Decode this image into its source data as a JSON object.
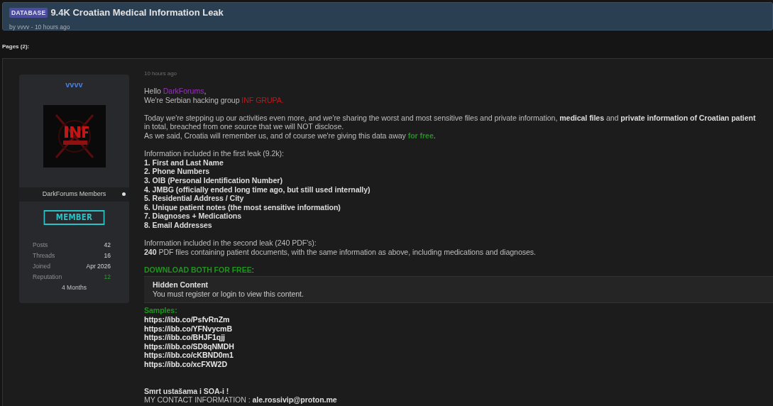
{
  "thread": {
    "tag": "DATABASE",
    "title": "9.4K Croatian Medical Information Leak",
    "byline": "by vvvv - 10 hours ago"
  },
  "pagination": {
    "label": "Pages (2):"
  },
  "post": {
    "author": {
      "username": "vvvv",
      "group": "DarkForums Members",
      "rank": "MEMBER",
      "stats": [
        {
          "label": "Posts",
          "value": "42",
          "kind": "count"
        },
        {
          "label": "Threads",
          "value": "16",
          "kind": "count"
        },
        {
          "label": "Joined",
          "value": "Apr 2026",
          "kind": "count"
        },
        {
          "label": "Reputation",
          "value": "12",
          "kind": "reputation"
        }
      ],
      "tenure": "4 Months"
    },
    "date": "10 hours ago",
    "body": [
      {
        "kind": "line",
        "segments": [
          {
            "text": "Hello "
          },
          {
            "text": "DarkForums",
            "color": "#9b2fc0"
          },
          {
            "text": ","
          }
        ]
      },
      {
        "kind": "line",
        "segments": [
          {
            "text": "We're Serbian hacking group "
          },
          {
            "text": "INF GRUPA.",
            "color": "#c01818"
          }
        ]
      },
      {
        "kind": "gap"
      },
      {
        "kind": "line",
        "segments": [
          {
            "text": "Today we're stepping up our activities even more, and we're sharing the worst and most sensitive files and private information, **medical files** and **private information of Croatian patient**"
          }
        ]
      },
      {
        "kind": "line",
        "segments": [
          {
            "text": "in total, breached from one source that we will NOT disclose."
          }
        ]
      },
      {
        "kind": "line",
        "segments": [
          {
            "text": "As we said, Croatia will remember us, and of course we're giving this data away "
          },
          {
            "text": "**for free**",
            "color": "#219321"
          },
          {
            "text": "."
          }
        ]
      },
      {
        "kind": "gap"
      },
      {
        "kind": "line",
        "segments": [
          {
            "text": "Information included in the first leak (9.2k):"
          }
        ]
      },
      {
        "kind": "line",
        "segments": [
          {
            "text": "**1. First and Last Name**"
          }
        ]
      },
      {
        "kind": "line",
        "segments": [
          {
            "text": "**2. Phone Numbers**"
          }
        ]
      },
      {
        "kind": "line",
        "segments": [
          {
            "text": "**3. OIB (Personal Identification Number)**"
          }
        ]
      },
      {
        "kind": "line",
        "segments": [
          {
            "text": "**4. JMBG (officially ended long time ago, but still used internally)**"
          }
        ]
      },
      {
        "kind": "line",
        "segments": [
          {
            "text": "**5. Residential Address / City**"
          }
        ]
      },
      {
        "kind": "line",
        "segments": [
          {
            "text": "**6. Unique patient notes (the most sensitive information)**"
          }
        ]
      },
      {
        "kind": "line",
        "segments": [
          {
            "text": "**7. Diagnoses + Medications**"
          }
        ]
      },
      {
        "kind": "line",
        "segments": [
          {
            "text": "**8. Email Addresses**"
          }
        ]
      },
      {
        "kind": "gap"
      },
      {
        "kind": "line",
        "segments": [
          {
            "text": "Information included in the second leak (240 PDF's):"
          }
        ]
      },
      {
        "kind": "line",
        "segments": [
          {
            "text": "**240** PDF files containing patient documents, with the same information as above, including medications and diagnoses."
          }
        ]
      },
      {
        "kind": "gap"
      },
      {
        "kind": "line",
        "segments": [
          {
            "text": "**DOWNLOAD BOTH FOR FREE**",
            "color": "#219321"
          },
          {
            "text": ":"
          }
        ]
      },
      {
        "kind": "hidden",
        "title": "Hidden Content",
        "message": "You must register or login to view this content."
      },
      {
        "kind": "line",
        "segments": [
          {
            "text": "**Samples:**",
            "color": "#219321"
          }
        ]
      },
      {
        "kind": "link",
        "text": "https://ibb.co/PsfvRnZm"
      },
      {
        "kind": "link",
        "text": "https://ibb.co/YFNvycmB"
      },
      {
        "kind": "link",
        "text": "https://ibb.co/BHJF1qjj"
      },
      {
        "kind": "link",
        "text": "https://ibb.co/SD8qNMDH"
      },
      {
        "kind": "link",
        "text": "https://ibb.co/cKBND0m1"
      },
      {
        "kind": "link",
        "text": "https://ibb.co/xcFXW2D"
      },
      {
        "kind": "gap"
      },
      {
        "kind": "gap"
      },
      {
        "kind": "line",
        "segments": [
          {
            "text": "**Smrt ustašama i SOA-i !**"
          }
        ]
      },
      {
        "kind": "line",
        "segments": [
          {
            "text": "MY CONTACT INFORMATION : **ale.rossivip@proton.me**"
          }
        ]
      }
    ]
  }
}
